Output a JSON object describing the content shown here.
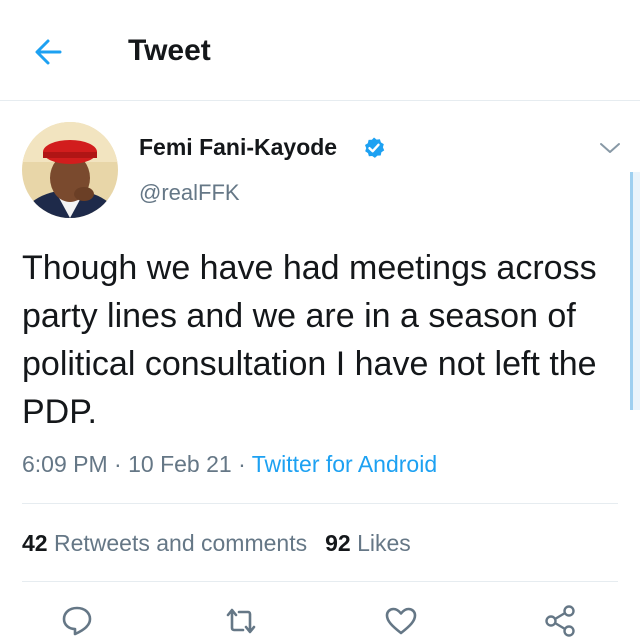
{
  "header": {
    "title": "Tweet",
    "back_icon": "arrow-left-icon"
  },
  "tweet": {
    "author": {
      "name": "Femi Fani-Kayode",
      "handle": "@realFFK",
      "verified_icon": "verified-badge-icon"
    },
    "text": "Though we have had meetings across party lines and we are in a season of political consultation I have not left the PDP.",
    "time": "6:09 PM",
    "date": "10 Feb 21",
    "separator": "·",
    "source": "Twitter for Android",
    "stats": {
      "retweets_count": "42",
      "retweets_label": "Retweets and comments",
      "likes_count": "92",
      "likes_label": "Likes"
    }
  },
  "actions": [
    {
      "name": "reply",
      "icon": "speech-bubble-icon"
    },
    {
      "name": "retweet",
      "icon": "retweet-icon"
    },
    {
      "name": "like",
      "icon": "heart-icon"
    },
    {
      "name": "share",
      "icon": "share-icon"
    }
  ],
  "colors": {
    "accent": "#1da1f2",
    "text_primary": "#14171a",
    "text_secondary": "#657786",
    "divider": "#e6ecf0"
  }
}
